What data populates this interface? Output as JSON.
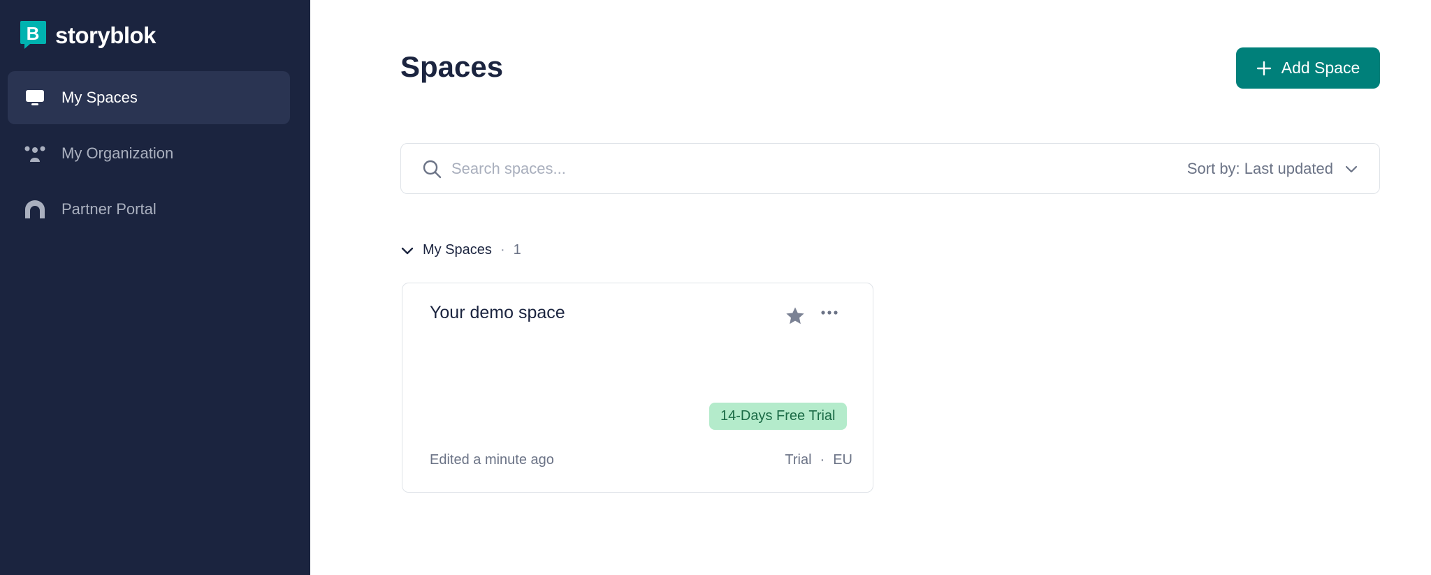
{
  "brand": {
    "name": "storyblok",
    "logo_letter": "B",
    "accent": "#00b3b0"
  },
  "sidebar": {
    "items": [
      {
        "label": "My Spaces",
        "icon": "monitor-icon",
        "active": true
      },
      {
        "label": "My Organization",
        "icon": "people-icon",
        "active": false
      },
      {
        "label": "Partner Portal",
        "icon": "portal-icon",
        "active": false
      }
    ]
  },
  "header": {
    "title": "Spaces",
    "add_button_label": "Add Space"
  },
  "search": {
    "placeholder": "Search spaces...",
    "value": "",
    "sort_label": "Sort by: Last updated"
  },
  "section": {
    "label": "My Spaces",
    "separator": "·",
    "count": "1"
  },
  "spaces": [
    {
      "title": "Your demo space",
      "badge": "14-Days Free Trial",
      "edited": "Edited a minute ago",
      "plan": "Trial",
      "separator": "·",
      "region": "EU"
    }
  ],
  "colors": {
    "sidebar_bg": "#1b243f",
    "primary_button": "#00807a",
    "badge_bg": "#b4ebcb",
    "badge_text": "#1b6b46"
  }
}
